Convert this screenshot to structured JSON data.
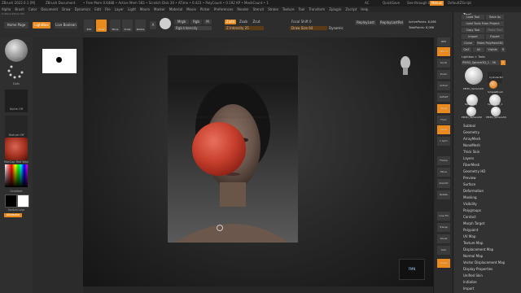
{
  "titlebar": {
    "app_title": "ZBrush 2022.0.1 [M]",
    "document": "ZBrush Document",
    "stats": "• Free Mem 0.6488 • Active Mem 583 • Scratch Disk 30 • ATime • 0.423 • PolyCount • 0.192 KP • MeshCount • 1",
    "ac": "AC",
    "quicksave": "QuickSave",
    "seethrough": "See-through 0",
    "menus_label": "Menus",
    "script": "DefaultZScript"
  },
  "menubar": {
    "items": [
      "Alpha",
      "Brush",
      "Color",
      "Document",
      "Draw",
      "Dynamics",
      "Edit",
      "File",
      "Layer",
      "Light",
      "Macro",
      "Marker",
      "Material",
      "Movie",
      "Picker",
      "Preferences",
      "Render",
      "Stencil",
      "Stroke",
      "Texture",
      "Tool",
      "Transform",
      "Zplugin",
      "Zscript",
      "Help"
    ]
  },
  "coords": "0.452,0.953,0.744",
  "toolbar": {
    "home_page": "Home Page",
    "lightbox": "LightBox",
    "live_boolean": "Live Boolean",
    "edit": "Edit",
    "draw": "Draw",
    "move": "Move",
    "scale": "Scale",
    "rotate": "Rotate",
    "a_label": "A",
    "mrgb": "Mrgb",
    "rgb": "Rgb",
    "m": "M",
    "zadd": "Zadd",
    "zsub": "Zsub",
    "zcut": "Zcut",
    "rgb_intensity": "Rgb Intensity",
    "z_intensity": "Z Intensity 25",
    "focal_shift": "Focal Shift 0",
    "draw_size": "Draw Size 64",
    "dynamic": "Dynamic",
    "replay_last": "ReplayLast",
    "replay_last_rel": "ReplayLastRel",
    "active_points": "ActivePoints: 8,066",
    "total_points": "TotalPoints: 8,066"
  },
  "left_shelf": {
    "brush_label": "Standard",
    "stroke_label": "Dots",
    "alpha_label": "Alpha Off",
    "texture_label": "Texture Off",
    "material_label": "MatCap Red Wax",
    "gradient_label": "Gradient",
    "switch_color": "SwitchColor",
    "alternate": "Alternate"
  },
  "right_strip": {
    "buttons": [
      "BPR",
      "SPix 3",
      "Scroll",
      "Zoom",
      "Actual",
      "AAHalf",
      "Persp",
      "Floor",
      "Local",
      "L.Sym",
      "Frame",
      "Move",
      "ZoomD",
      "Rotate",
      "Line Fill PolyF",
      "Transp",
      "Ghost",
      "Solo",
      "Xpose"
    ]
  },
  "tool_panel": {
    "title": "Tool",
    "load_tool": "Load Tool",
    "save_as": "Save As",
    "load_from_project": "Load Tools From Project",
    "copy_tool": "Copy Tool",
    "paste_tool": "Paste Tool",
    "import": "Import",
    "export": "Export",
    "clone": "Clone",
    "make_polymesh": "Make PolyMesh3D",
    "goz": "GoZ",
    "all": "All",
    "visible": "Visible",
    "r": "R",
    "lightbox_tools": "Lightbox > Tools",
    "current_tool": "PM3D_Sphere3D_1 . 36",
    "r_label": "R",
    "subtools": [
      {
        "name": "PM3D_Sphere3D",
        "color": "#d9d9d9"
      },
      {
        "name": "SimpleBrush",
        "color": "#e58a2f"
      },
      {
        "name": "Sphere3D",
        "color": "#e0e0e0"
      },
      {
        "name": "Sphere3D_1",
        "color": "#e0e0e0"
      },
      {
        "name": "PM3D_Sphere3D",
        "color": "#e0e0e0"
      },
      {
        "name": "PM3D_Sphere3D",
        "color": "#e0e0e0"
      }
    ],
    "cylinder_label": "Cylinder3D",
    "list": [
      "Subtool",
      "Geometry",
      "ArrayMesh",
      "NanoMesh",
      "Thick Skin",
      "Layers",
      "FiberMesh",
      "Geometry HD",
      "Preview",
      "Surface",
      "Deformation",
      "Masking",
      "Visibility",
      "Polygroups",
      "Contact",
      "Morph Target",
      "Polypaint",
      "UV Map",
      "Texture Map",
      "Displacement Map",
      "Normal Map",
      "Vector Displacement Map",
      "Display Properties",
      "Unified Skin",
      "Initialize",
      "Import"
    ]
  },
  "viewport": {
    "logo_text": "FMN",
    "accent": "#e98a1f",
    "sphere_color": "#c63e2c"
  }
}
